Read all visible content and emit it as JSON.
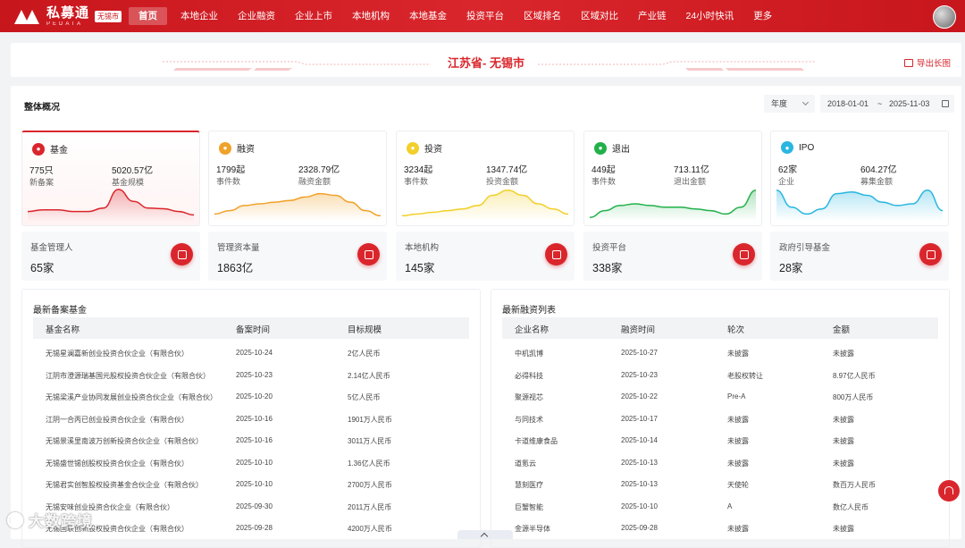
{
  "brand": {
    "name_cn": "私募通",
    "name_en": "PEDATA",
    "city_tag": "无锡市"
  },
  "nav": [
    {
      "label": "首页",
      "active": true
    },
    {
      "label": "本地企业"
    },
    {
      "label": "企业融资"
    },
    {
      "label": "企业上市"
    },
    {
      "label": "本地机构"
    },
    {
      "label": "本地基金"
    },
    {
      "label": "投资平台"
    },
    {
      "label": "区域排名"
    },
    {
      "label": "区域对比"
    },
    {
      "label": "产业链"
    },
    {
      "label": "24小时快讯"
    },
    {
      "label": "更多"
    }
  ],
  "title": "江苏省- 无锡市",
  "export_label": "导出长图",
  "overview": {
    "title": "整体概况",
    "period_select": "年度",
    "date_start": "2018-01-01",
    "date_sep": "~",
    "date_end": "2025-11-03"
  },
  "cards": [
    {
      "name": "基金",
      "icon": "fund-icon",
      "color": "#d9262c",
      "v1": "775只",
      "l1": "新备案",
      "v2": "5020.57亿",
      "l2": "基金规模",
      "trend": [
        0.3,
        0.35,
        0.35,
        0.3,
        0.3,
        0.4,
        0.95,
        0.6,
        0.4,
        0.38,
        0.3,
        0.2
      ]
    },
    {
      "name": "融资",
      "icon": "financing-icon",
      "color": "#f0a22a",
      "v1": "1799起",
      "l1": "事件数",
      "v2": "2328.79亿",
      "l2": "融资金额",
      "trend": [
        0.2,
        0.3,
        0.45,
        0.5,
        0.55,
        0.6,
        0.7,
        0.8,
        0.75,
        0.55,
        0.3,
        0.15
      ]
    },
    {
      "name": "投资",
      "icon": "investment-icon",
      "color": "#f2cf2a",
      "v1": "3234起",
      "l1": "事件数",
      "v2": "1347.74亿",
      "l2": "投资金额",
      "trend": [
        0.15,
        0.2,
        0.25,
        0.3,
        0.35,
        0.45,
        0.75,
        0.9,
        0.75,
        0.5,
        0.35,
        0.2
      ]
    },
    {
      "name": "退出",
      "icon": "exit-icon",
      "color": "#22b04a",
      "v1": "449起",
      "l1": "事件数",
      "v2": "713.11亿",
      "l2": "退出金额",
      "trend": [
        0.1,
        0.3,
        0.45,
        0.5,
        0.45,
        0.4,
        0.4,
        0.35,
        0.3,
        0.2,
        0.4,
        0.9
      ]
    },
    {
      "name": "IPO",
      "icon": "ipo-icon",
      "color": "#2ab6e0",
      "v1": "62家",
      "l1": "企业",
      "v2": "604.27亿",
      "l2": "募集金额",
      "trend": [
        0.9,
        0.4,
        0.2,
        0.35,
        0.8,
        0.85,
        0.75,
        0.55,
        0.45,
        0.5,
        0.9,
        0.3
      ]
    }
  ],
  "mini_cards": [
    {
      "label": "基金管理人",
      "value": "65家",
      "icon": "manager-icon"
    },
    {
      "label": "管理资本量",
      "value": "1863亿",
      "icon": "pie-chart-icon"
    },
    {
      "label": "本地机构",
      "value": "145家",
      "icon": "bank-icon"
    },
    {
      "label": "投资平台",
      "value": "338家",
      "icon": "bar-chart-icon"
    },
    {
      "label": "政府引导基金",
      "value": "28家",
      "icon": "trend-icon"
    }
  ],
  "fund_table": {
    "title": "最新备案基金",
    "headers": [
      "基金名称",
      "备案时间",
      "目标规模"
    ],
    "rows": [
      [
        "无锡星澜嘉新创业投资合伙企业（有限合伙）",
        "2025-10-24",
        "2亿人民币"
      ],
      [
        "江阴市澄源瑞基国元股权投资合伙企业（有限合伙）",
        "2025-10-23",
        "2.14亿人民币"
      ],
      [
        "无锡梁溪产业协同发展创业投资合伙企业（有限合伙）",
        "2025-10-20",
        "5亿人民币"
      ],
      [
        "江阴一合丙已创业投资合伙企业（有限合伙）",
        "2025-10-16",
        "1901万人民币"
      ],
      [
        "无锡景溪里南波万创新投资合伙企业（有限合伙）",
        "2025-10-16",
        "3011万人民币"
      ],
      [
        "无锡盛世锡创股权投资合伙企业（有限合伙）",
        "2025-10-10",
        "1.36亿人民币"
      ],
      [
        "无锡君实创智股权投资基金合伙企业（有限合伙）",
        "2025-10-10",
        "2700万人民币"
      ],
      [
        "无锡安味创业投资合伙企业（有限合伙）",
        "2025-09-30",
        "2011万人民币"
      ],
      [
        "无锡国联创新股权投资合伙企业（有限合伙）",
        "2025-09-28",
        "4200万人民币"
      ]
    ]
  },
  "financing_table": {
    "title": "最新融资列表",
    "headers": [
      "企业名称",
      "融资时间",
      "轮次",
      "金额"
    ],
    "rows": [
      [
        "中机凯博",
        "2025-10-27",
        "未披露",
        "未披露"
      ],
      [
        "必得科技",
        "2025-10-23",
        "老股权转让",
        "8.97亿人民币"
      ],
      [
        "聚源视芯",
        "2025-10-22",
        "Pre-A",
        "800万人民币"
      ],
      [
        "与同技术",
        "2025-10-17",
        "未披露",
        "未披露"
      ],
      [
        "卡道维康食品",
        "2025-10-14",
        "未披露",
        "未披露"
      ],
      [
        "道氪云",
        "2025-10-13",
        "未披露",
        "未披露"
      ],
      [
        "慧刻医疗",
        "2025-10-13",
        "天使轮",
        "数百万人民币"
      ],
      [
        "巨蟹智能",
        "2025-10-10",
        "A",
        "数亿人民币"
      ],
      [
        "金源半导体",
        "2025-09-28",
        "未披露",
        "未披露"
      ]
    ]
  },
  "watermark": "大数跨境"
}
